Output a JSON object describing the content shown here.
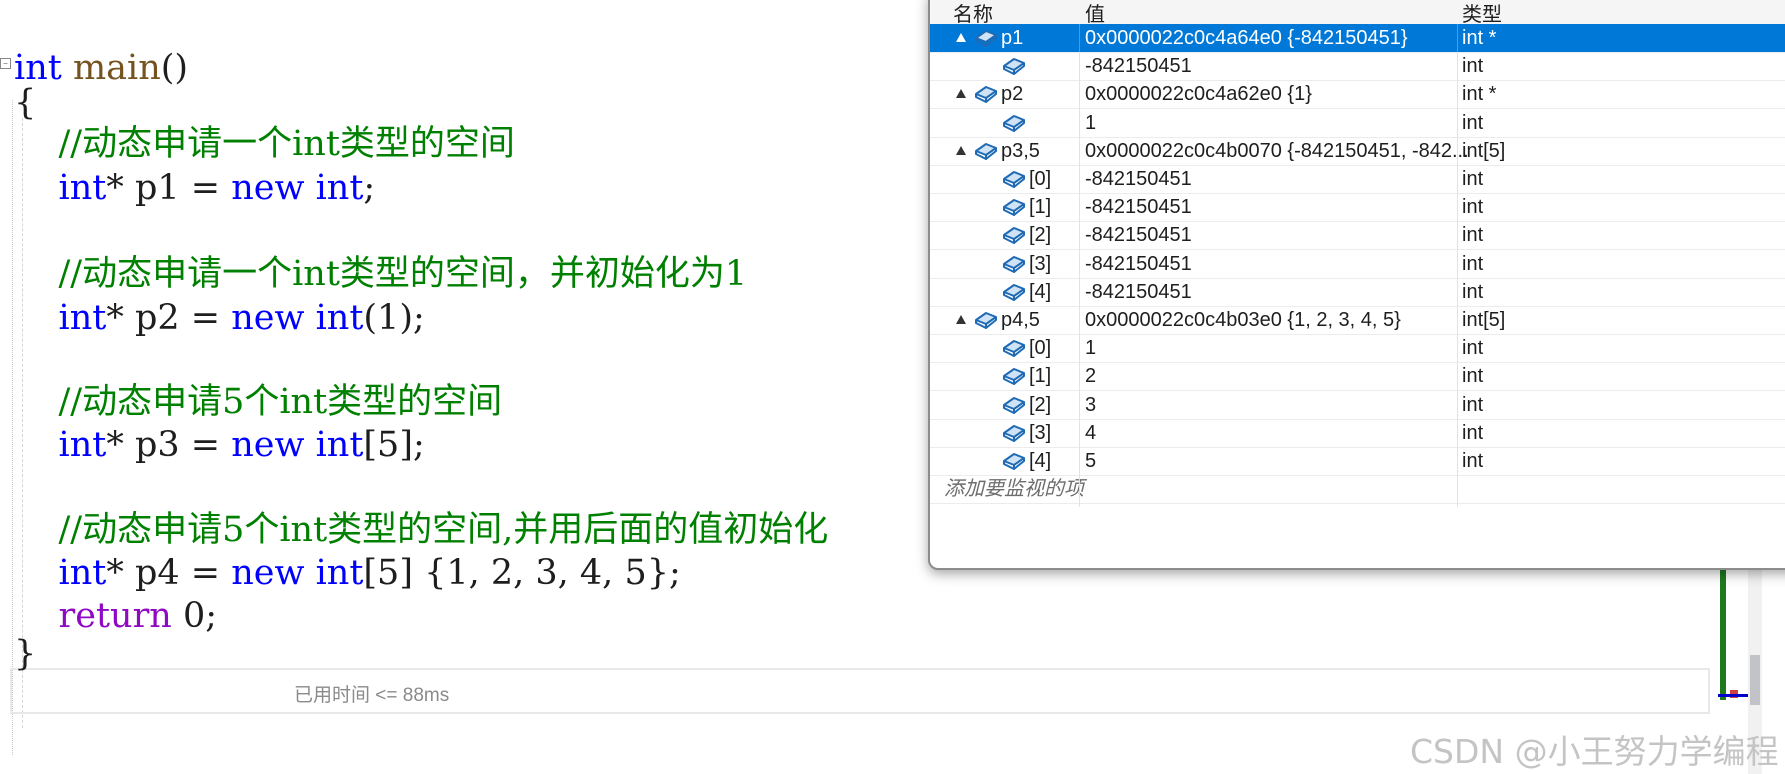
{
  "editor": {
    "lines": [
      [
        {
          "t": "int",
          "c": "kw"
        },
        {
          "t": " ",
          "c": "plain"
        },
        {
          "t": "main",
          "c": "fn"
        },
        {
          "t": "()",
          "c": "plain"
        }
      ],
      [
        {
          "t": "{",
          "c": "plain"
        }
      ],
      [
        {
          "t": "    //动态申请一个int类型的空间",
          "c": "cm"
        }
      ],
      [
        {
          "t": "    ",
          "c": "plain"
        },
        {
          "t": "int",
          "c": "kw"
        },
        {
          "t": "* p1 = ",
          "c": "plain"
        },
        {
          "t": "new",
          "c": "kw"
        },
        {
          "t": " ",
          "c": "plain"
        },
        {
          "t": "int",
          "c": "kw"
        },
        {
          "t": ";",
          "c": "plain"
        }
      ],
      [
        {
          "t": "",
          "c": "plain"
        }
      ],
      [
        {
          "t": "    //动态申请一个int类型的空间，并初始化为1",
          "c": "cm"
        }
      ],
      [
        {
          "t": "    ",
          "c": "plain"
        },
        {
          "t": "int",
          "c": "kw"
        },
        {
          "t": "* p2 = ",
          "c": "plain"
        },
        {
          "t": "new",
          "c": "kw"
        },
        {
          "t": " ",
          "c": "plain"
        },
        {
          "t": "int",
          "c": "kw"
        },
        {
          "t": "(1);",
          "c": "plain"
        }
      ],
      [
        {
          "t": "",
          "c": "plain"
        }
      ],
      [
        {
          "t": "    //动态申请5个int类型的空间",
          "c": "cm"
        }
      ],
      [
        {
          "t": "    ",
          "c": "plain"
        },
        {
          "t": "int",
          "c": "kw"
        },
        {
          "t": "* p3 = ",
          "c": "plain"
        },
        {
          "t": "new",
          "c": "kw"
        },
        {
          "t": " ",
          "c": "plain"
        },
        {
          "t": "int",
          "c": "kw"
        },
        {
          "t": "[5];",
          "c": "plain"
        }
      ],
      [
        {
          "t": "",
          "c": "plain"
        }
      ],
      [
        {
          "t": "    //动态申请5个int类型的空间,并用后面的值初始化",
          "c": "cm"
        }
      ],
      [
        {
          "t": "    ",
          "c": "plain"
        },
        {
          "t": "int",
          "c": "kw"
        },
        {
          "t": "* p4 = ",
          "c": "plain"
        },
        {
          "t": "new",
          "c": "kw"
        },
        {
          "t": " ",
          "c": "plain"
        },
        {
          "t": "int",
          "c": "kw"
        },
        {
          "t": "[5] {1, 2, 3, 4, 5};",
          "c": "plain"
        }
      ],
      [
        {
          "t": "    ",
          "c": "plain"
        },
        {
          "t": "return",
          "c": "ret"
        },
        {
          "t": " 0;",
          "c": "plain"
        }
      ],
      [
        {
          "t": "}",
          "c": "plain"
        }
      ]
    ],
    "fold_glyph": "−",
    "elapsed_hint": "已用时间 <= 88ms",
    "watermark": "CSDN @小王努力学编程"
  },
  "watch": {
    "columns": {
      "name": "名称",
      "value": "值",
      "type": "类型"
    },
    "rows": [
      {
        "name": "p1",
        "value": "0x0000022c0c4a64e0 {-842150451}",
        "type": "int *",
        "level": 0,
        "expanded": true,
        "selected": true
      },
      {
        "name": "",
        "value": "-842150451",
        "type": "int",
        "level": 1
      },
      {
        "name": "p2",
        "value": "0x0000022c0c4a62e0 {1}",
        "type": "int *",
        "level": 0,
        "expanded": true
      },
      {
        "name": "",
        "value": "1",
        "type": "int",
        "level": 1
      },
      {
        "name": "p3,5",
        "value": "0x0000022c0c4b0070 {-842150451, -842...",
        "type": "int[5]",
        "level": 0,
        "expanded": true
      },
      {
        "name": "[0]",
        "value": "-842150451",
        "type": "int",
        "level": 1
      },
      {
        "name": "[1]",
        "value": "-842150451",
        "type": "int",
        "level": 1
      },
      {
        "name": "[2]",
        "value": "-842150451",
        "type": "int",
        "level": 1
      },
      {
        "name": "[3]",
        "value": "-842150451",
        "type": "int",
        "level": 1
      },
      {
        "name": "[4]",
        "value": "-842150451",
        "type": "int",
        "level": 1
      },
      {
        "name": "p4,5",
        "value": "0x0000022c0c4b03e0 {1, 2, 3, 4, 5}",
        "type": "int[5]",
        "level": 0,
        "expanded": true
      },
      {
        "name": "[0]",
        "value": "1",
        "type": "int",
        "level": 1
      },
      {
        "name": "[1]",
        "value": "2",
        "type": "int",
        "level": 1
      },
      {
        "name": "[2]",
        "value": "3",
        "type": "int",
        "level": 1
      },
      {
        "name": "[3]",
        "value": "4",
        "type": "int",
        "level": 1
      },
      {
        "name": "[4]",
        "value": "5",
        "type": "int",
        "level": 1
      }
    ],
    "add_item_placeholder": "添加要监视的项",
    "icon": "variable-object-icon"
  },
  "colors": {
    "keyword": "#0000ff",
    "comment": "#008000",
    "return_keyword": "#8f08c4",
    "selection": "#0078d7"
  }
}
